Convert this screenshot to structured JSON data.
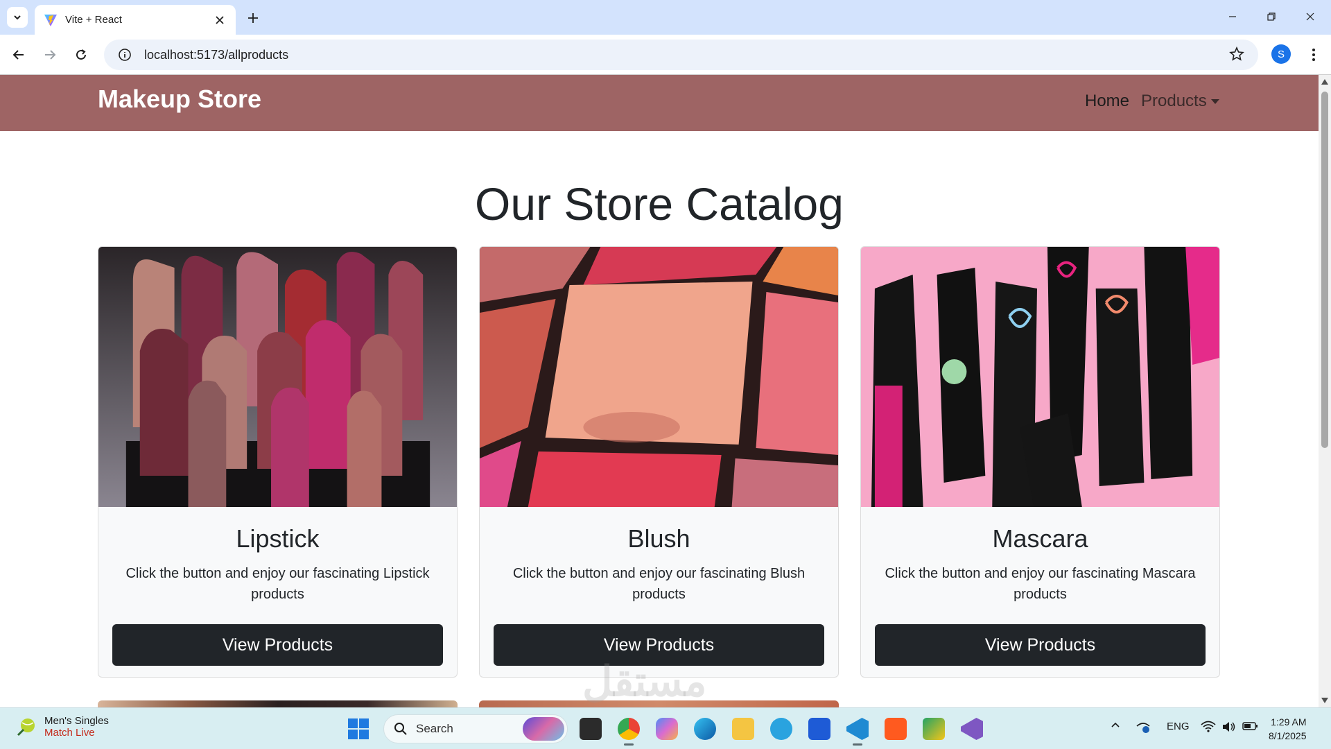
{
  "browser": {
    "tab_title": "Vite + React",
    "url": "localhost:5173/allproducts",
    "profile_initial": "S"
  },
  "site": {
    "brand": "Makeup Store",
    "nav": {
      "home": "Home",
      "products": "Products"
    },
    "page_title": "Our Store Catalog",
    "cards": [
      {
        "title": "Lipstick",
        "text": "Click the button and enjoy our fascinating Lipstick products",
        "button": "View Products"
      },
      {
        "title": "Blush",
        "text": "Click the button and enjoy our fascinating Blush products",
        "button": "View Products"
      },
      {
        "title": "Mascara",
        "text": "Click the button and enjoy our fascinating Mascara products",
        "button": "View Products"
      }
    ],
    "watermark": "مستقل"
  },
  "taskbar": {
    "widget_title": "Men's Singles",
    "widget_subtitle": "Match Live",
    "search_placeholder": "Search",
    "language": "ENG",
    "time": "1:29 AM",
    "date": "8/1/2025"
  },
  "colors": {
    "navbar": "#9e6464",
    "button": "#212529",
    "card_bg": "#f8f9fa",
    "taskbar": "#d8eef2",
    "tabbar": "#d3e3fd"
  }
}
